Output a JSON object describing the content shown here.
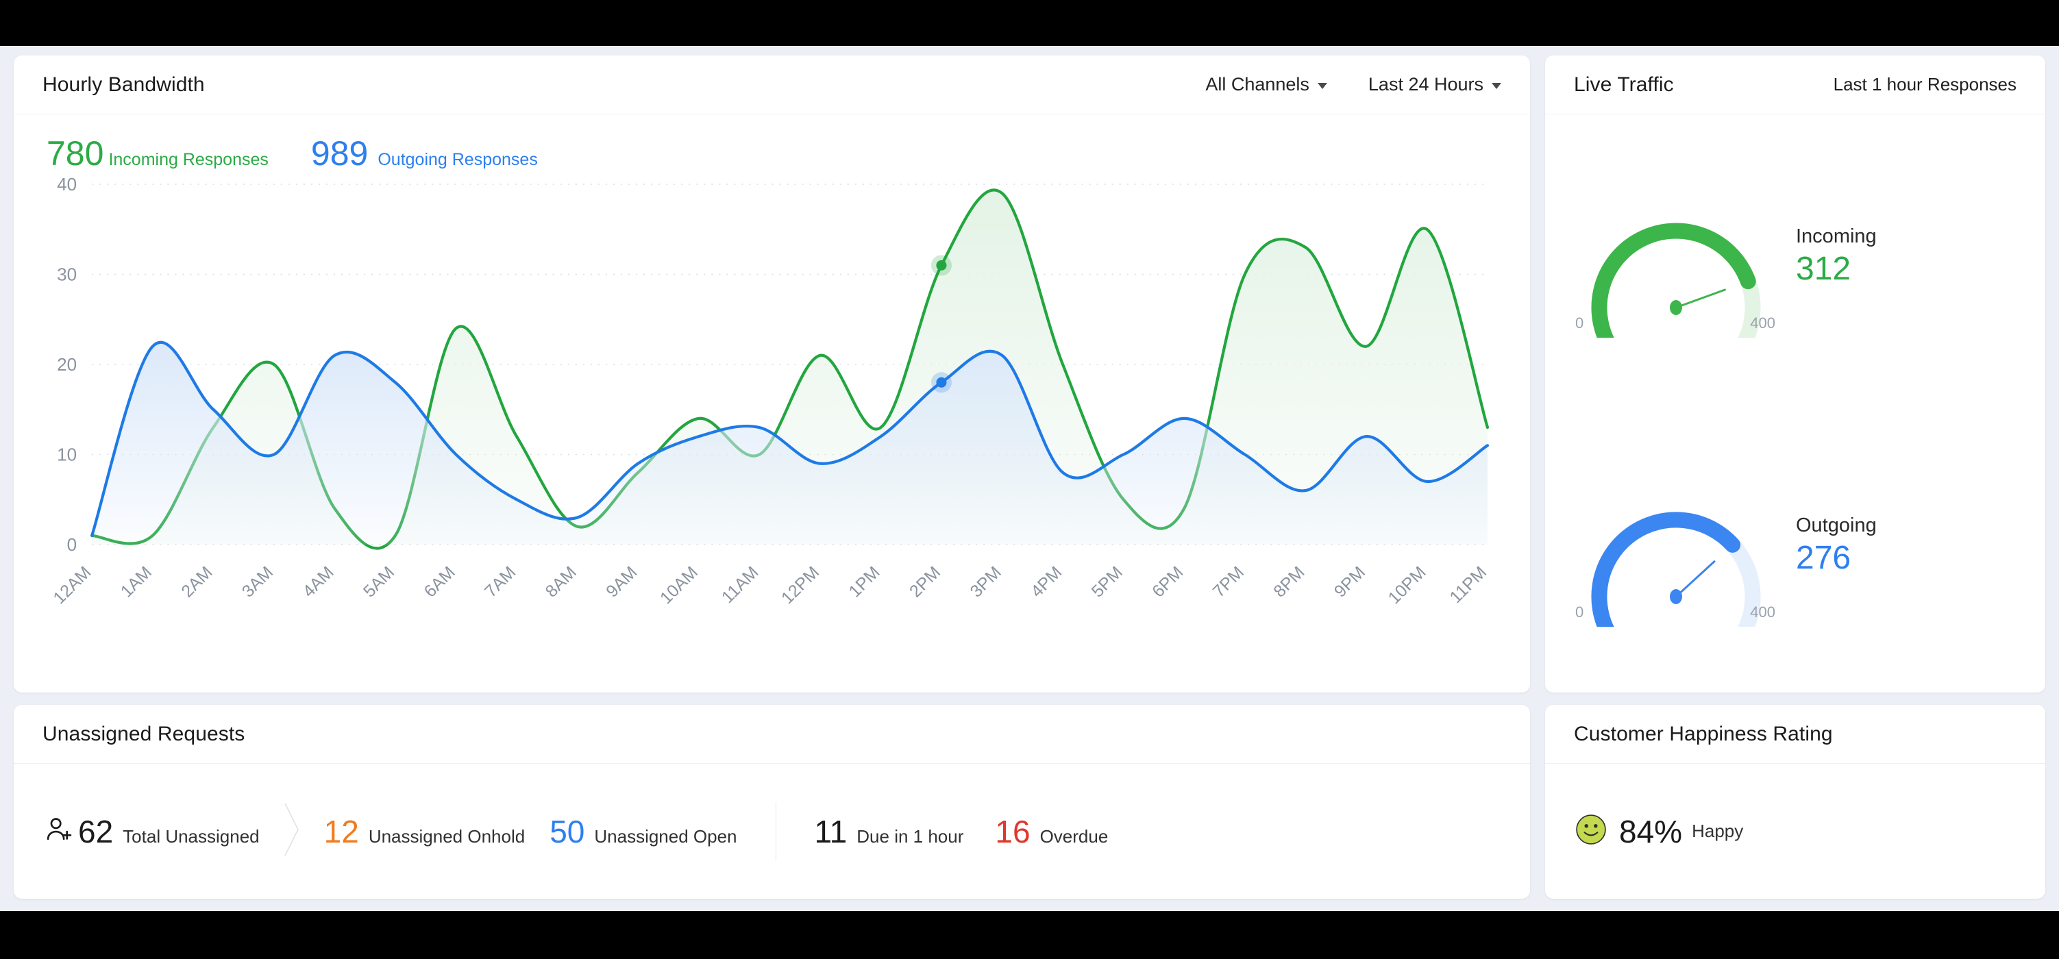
{
  "bandwidth": {
    "title": "Hourly Bandwidth",
    "channel_filter": "All Channels",
    "time_filter": "Last 24 Hours",
    "legend": {
      "incoming_value": "780",
      "incoming_label": "Incoming Responses",
      "outgoing_value": "989",
      "outgoing_label": "Outgoing Responses"
    }
  },
  "live_traffic": {
    "title": "Live Traffic",
    "note": "Last 1 hour Responses",
    "gauges": [
      {
        "label": "Incoming",
        "value": "312",
        "min": "0",
        "max": "400",
        "value_num": 312,
        "max_num": 400,
        "color": "#3cb54a",
        "track": "#e3f3e4"
      },
      {
        "label": "Outgoing",
        "value": "276",
        "min": "0",
        "max": "400",
        "value_num": 276,
        "max_num": 400,
        "color": "#3b86f0",
        "track": "#e6effc"
      }
    ]
  },
  "unassigned": {
    "title": "Unassigned Requests",
    "stats": [
      {
        "num": "62",
        "label": "Total Unassigned",
        "color": "#1b1b1b"
      },
      {
        "num": "12",
        "label": "Unassigned Onhold",
        "color": "#f07c1e"
      },
      {
        "num": "50",
        "label": "Unassigned Open",
        "color": "#2d7ff0"
      },
      {
        "num": "11",
        "label": "Due in 1 hour",
        "color": "#1b1b1b"
      },
      {
        "num": "16",
        "label": "Overdue",
        "color": "#e0362c"
      }
    ]
  },
  "happiness": {
    "title": "Customer Happiness Rating",
    "percent": "84%",
    "label": "Happy"
  },
  "chart_data": {
    "type": "area",
    "title": "Hourly Bandwidth",
    "xlabel": "",
    "ylabel": "",
    "ylim": [
      0,
      40
    ],
    "yticks": [
      0,
      10,
      20,
      30,
      40
    ],
    "grid": true,
    "legend_position": "top-left",
    "categories": [
      "12AM",
      "1AM",
      "2AM",
      "3AM",
      "4AM",
      "5AM",
      "6AM",
      "7AM",
      "8AM",
      "9AM",
      "10AM",
      "11AM",
      "12PM",
      "1PM",
      "2PM",
      "3PM",
      "4PM",
      "5PM",
      "6PM",
      "7PM",
      "8PM",
      "9PM",
      "10PM",
      "11PM"
    ],
    "series": [
      {
        "name": "Incoming Responses",
        "color": "#22a63f",
        "fill": "#e4f3e6",
        "values": [
          1,
          1,
          13,
          20,
          4,
          1,
          24,
          12,
          2,
          8,
          14,
          10,
          21,
          13,
          31,
          39,
          20,
          5,
          4,
          30,
          33,
          22,
          35,
          13
        ]
      },
      {
        "name": "Outgoing Responses",
        "color": "#1e7ae6",
        "fill": "#dce9fa",
        "values": [
          1,
          22,
          15,
          10,
          21,
          18,
          10,
          5,
          3,
          9,
          12,
          13,
          9,
          12,
          18,
          21,
          8,
          10,
          14,
          10,
          6,
          12,
          7,
          11
        ]
      }
    ],
    "active_points": [
      {
        "series": "Incoming Responses",
        "x": "2PM",
        "y": 31
      },
      {
        "series": "Outgoing Responses",
        "x": "2PM",
        "y": 18
      }
    ]
  }
}
